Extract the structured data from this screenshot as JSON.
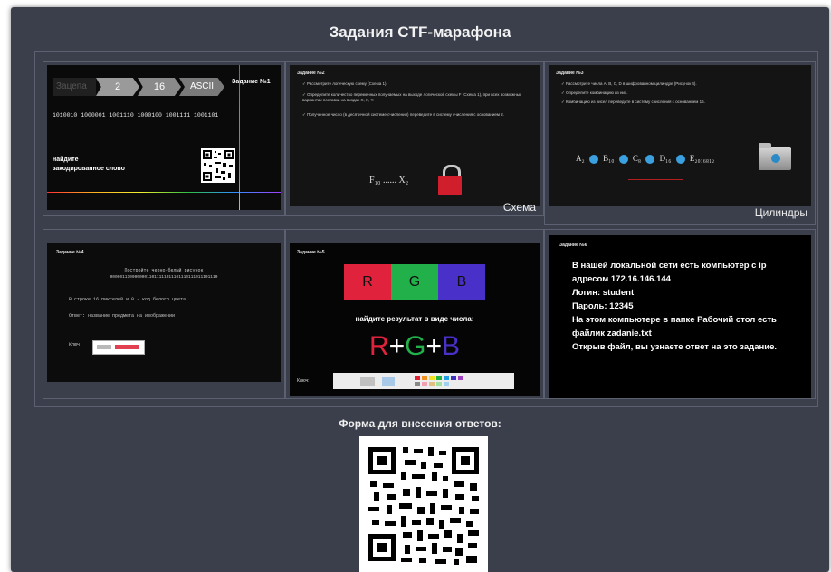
{
  "page": {
    "title": "Задания CTF-марафона",
    "form_title": "Форма для внесения ответов:"
  },
  "tasks": {
    "t1": {
      "steps": [
        "Зацепа",
        "2",
        "16",
        "ASCII"
      ],
      "label": "Задание №1",
      "binary": "1010010 1000001 1001110 1000100 1001111 1001101",
      "text1": "найдите",
      "text2": "закодированное слово"
    },
    "t2": {
      "title": "Задание №2",
      "bullets": [
        "Рассмотрите логическую схему (Схема 1).",
        "Определите количество переменных получаемых на выходе логической схемы F (Схема 1), при всех возможных вариантах поставки на входах X, X, Y.",
        "Полученное число (в десятичной системе счисления) переведите в систему счисления с основанием 2."
      ],
      "formula_left": "F₁₀ ...... X₂",
      "caption": "Схема"
    },
    "t3": {
      "title": "Задание №3",
      "bullets": [
        "Рассмотрите числа A, B, C, D в шифрованном цилиндре (Рисунок 4).",
        "Определите комбинацию из них.",
        "Комбинацию из чисел переведите в систему счисления с основанием 16."
      ],
      "chain": [
        "A₂",
        "B₁₀",
        "C₈",
        "D₁₆",
        "E₂₀₁₆₈₁₂"
      ],
      "caption": "Цилиндры"
    },
    "t4": {
      "title": "Задание №4",
      "line1": "Постройте черно-белый рисунок",
      "line2": "00000111000000011011111011101110111011101110",
      "line3": "В строке 16 пикселей и 0 - код белого цвета",
      "line4": "Ответ: название предмета на изображении",
      "key_label": "Ключ:"
    },
    "t5": {
      "title": "Задание №5",
      "rgb_labels": [
        "R",
        "G",
        "B"
      ],
      "prompt": "найдите результат в виде числа:",
      "formula": [
        "R",
        "+",
        "G",
        "+",
        "B"
      ],
      "key_label": "Ключ:"
    },
    "t6": {
      "title": "Задание №6",
      "lines": [
        "В нашей локальной сети есть компьютер с ip",
        "адресом 172.16.146.144",
        "Логин: student",
        "Пароль: 12345",
        "На этом компьютере в папке Рабочий стол есть",
        "файлик zadanie.txt",
        "Открыв файл, вы узнаете ответ на это задание."
      ]
    }
  },
  "colors": {
    "red": "#e0223c",
    "green": "#22b04a",
    "blue": "#4830c8",
    "bg": "#3a3f4b"
  }
}
